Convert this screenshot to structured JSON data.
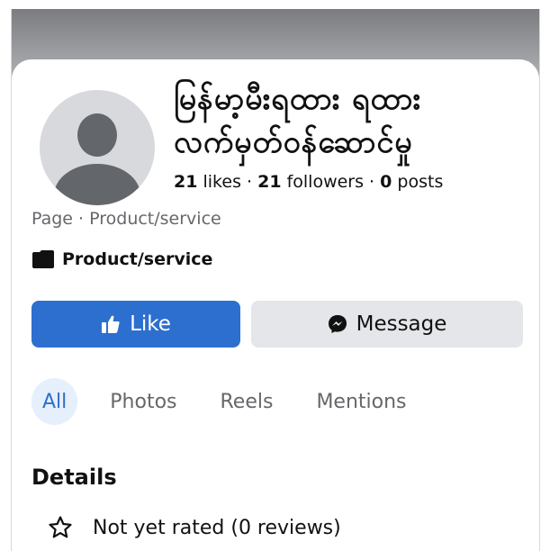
{
  "page": {
    "name_line1": "မြန်မာ့မီးရထား ရထား",
    "name_line2": "လက်မှတ်ဝန်ဆောင်မှု",
    "likes_count": "21",
    "likes_label": " likes · ",
    "followers_count": "21",
    "followers_label": " followers · ",
    "posts_count": "0",
    "posts_label": " posts",
    "page_type_line": "Page · Product/service",
    "category": "Product/service"
  },
  "buttons": {
    "like_label": "Like",
    "message_label": "Message"
  },
  "tabs": [
    {
      "label": "All",
      "active": true
    },
    {
      "label": "Photos",
      "active": false
    },
    {
      "label": "Reels",
      "active": false
    },
    {
      "label": "Mentions",
      "active": false
    }
  ],
  "details": {
    "title": "Details",
    "rating_text": "Not yet rated (0 reviews)"
  },
  "colors": {
    "accent": "#2d6fcf",
    "secondary_button": "#e4e6e9",
    "muted_text": "#65676b"
  },
  "icons": {
    "like": "thumbs-up-icon",
    "message": "messenger-icon",
    "category": "category-icon",
    "rating": "star-outline-icon"
  }
}
